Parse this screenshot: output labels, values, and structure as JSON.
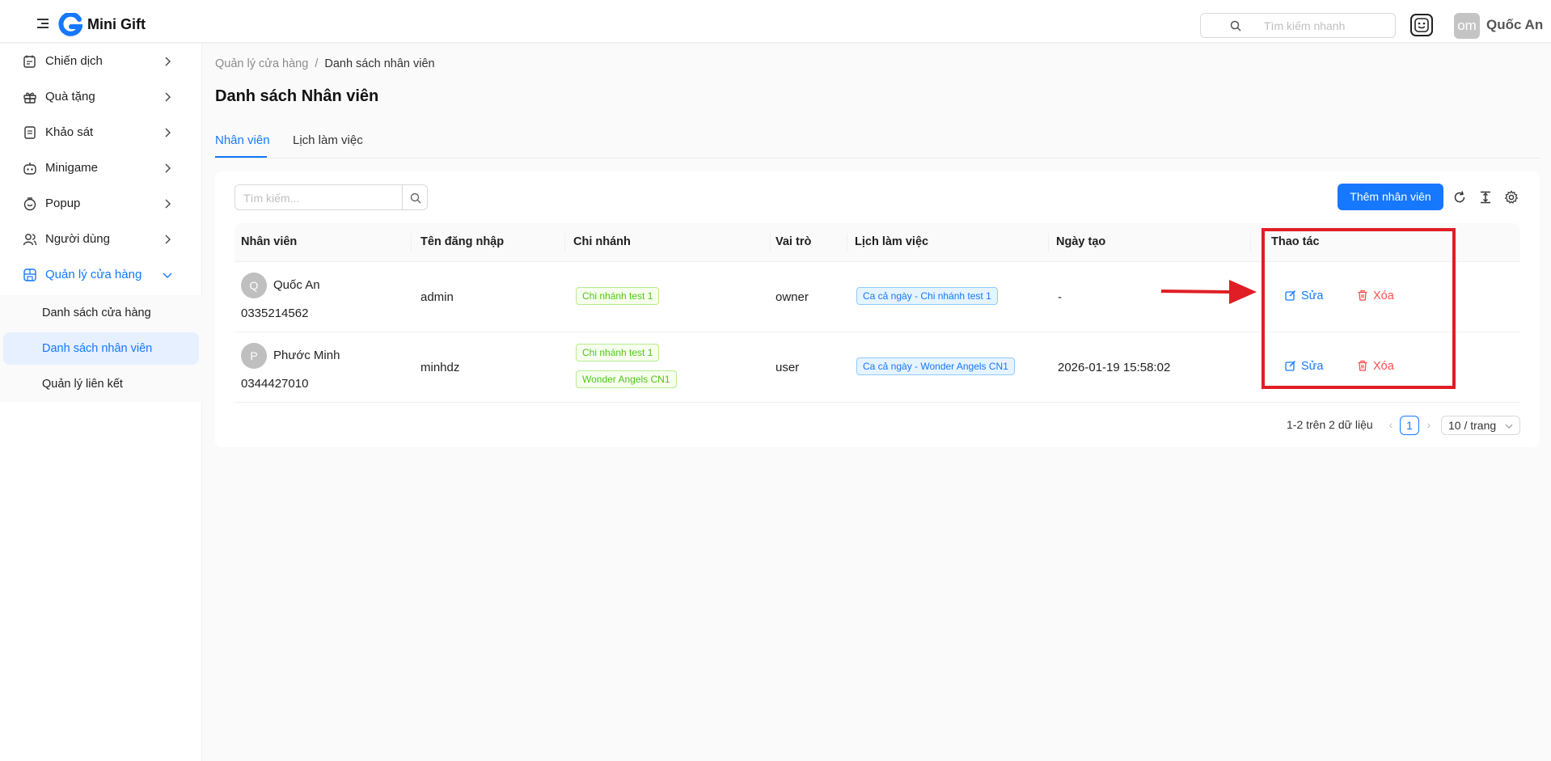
{
  "header": {
    "brand": "Mini Gift",
    "search_placeholder": "Tìm kiếm nhanh",
    "avatar_initials": "om",
    "user_name": "Quốc An"
  },
  "sidebar": {
    "items": [
      {
        "label": "Chiến dịch",
        "icon": "calendar-edit-icon"
      },
      {
        "label": "Quà tặng",
        "icon": "gift-icon"
      },
      {
        "label": "Khảo sát",
        "icon": "survey-icon"
      },
      {
        "label": "Minigame",
        "icon": "robot-icon"
      },
      {
        "label": "Popup",
        "icon": "popup-icon"
      },
      {
        "label": "Người dùng",
        "icon": "users-icon"
      },
      {
        "label": "Quản lý cửa hàng",
        "icon": "store-icon"
      }
    ],
    "sub_items": [
      {
        "label": "Danh sách cửa hàng"
      },
      {
        "label": "Danh sách nhân viên"
      },
      {
        "label": "Quản lý liên kết"
      }
    ]
  },
  "breadcrumb": {
    "parent": "Quản lý cửa hàng",
    "separator": "/",
    "current": "Danh sách nhân viên"
  },
  "page_title": "Danh sách Nhân viên",
  "tabs": [
    {
      "label": "Nhân viên"
    },
    {
      "label": "Lịch làm việc"
    }
  ],
  "toolbar": {
    "search_placeholder": "Tìm kiếm...",
    "add_label": "Thêm nhân viên"
  },
  "table": {
    "columns": [
      "Nhân viên",
      "Tên đăng nhập",
      "Chi nhánh",
      "Vai trò",
      "Lịch làm việc",
      "Ngày tạo",
      "Thao tác"
    ],
    "rows": [
      {
        "initial": "Q",
        "name": "Quốc An",
        "phone": "0335214562",
        "username": "admin",
        "branches": [
          "Chi nhánh test 1"
        ],
        "role": "owner",
        "schedule": "Ca cả ngày - Chi nhánh test 1",
        "created": "-",
        "edit_label": "Sửa",
        "delete_label": "Xóa"
      },
      {
        "initial": "P",
        "name": "Phước Minh",
        "phone": "0344427010",
        "username": "minhdz",
        "branches": [
          "Chi nhánh test 1",
          "Wonder Angels CN1"
        ],
        "role": "user",
        "schedule": "Ca cả ngày - Wonder Angels CN1",
        "created": "2026-01-19 15:58:02",
        "edit_label": "Sửa",
        "delete_label": "Xóa"
      }
    ]
  },
  "pagination": {
    "summary": "1-2 trên 2 dữ liệu",
    "current_page": "1",
    "page_size": "10 / trang"
  },
  "colors": {
    "primary": "#1677ff",
    "danger": "#ff4d4f",
    "success": "#52c41a",
    "annotation": "#e01e26"
  }
}
